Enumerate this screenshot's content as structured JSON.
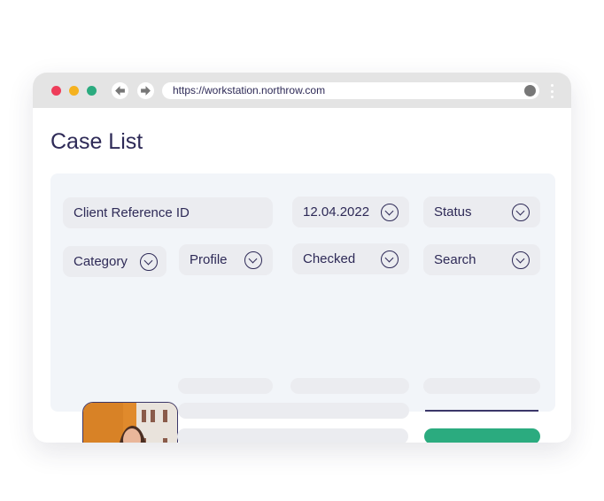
{
  "browser": {
    "url": "https://workstation.northrow.com",
    "dots": [
      "#ee3d5a",
      "#f5b21f",
      "#2bab7f"
    ]
  },
  "page": {
    "title": "Case List"
  },
  "filters": {
    "client_ref": "Client Reference ID",
    "date": "12.04.2022",
    "status": "Status",
    "category": "Category",
    "profile": "Profile",
    "checked": "Checked",
    "search": "Search"
  },
  "colors": {
    "accent": "#2e2a57",
    "success": "#2bab7f",
    "danger": "#ee3d5a"
  }
}
